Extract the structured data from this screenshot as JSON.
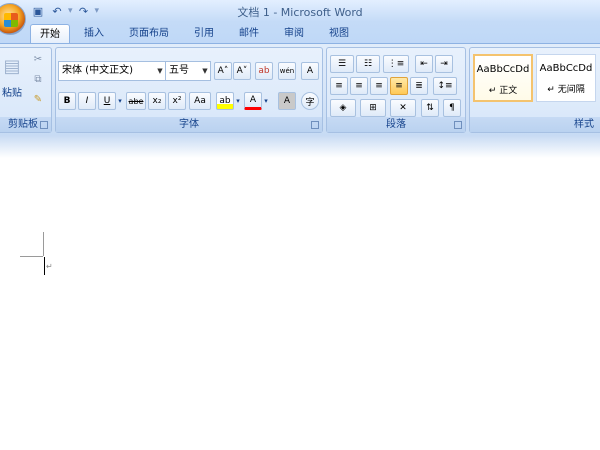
{
  "window": {
    "title": "文档 1 - Microsoft Word"
  },
  "qat": {
    "separator": "▾"
  },
  "tabs": [
    {
      "label": "开始",
      "active": true
    },
    {
      "label": "插入"
    },
    {
      "label": "页面布局"
    },
    {
      "label": "引用"
    },
    {
      "label": "邮件"
    },
    {
      "label": "审阅"
    },
    {
      "label": "视图"
    }
  ],
  "ribbon": {
    "clipboard": {
      "label": "剪贴板",
      "paste": "粘贴"
    },
    "font": {
      "label": "字体",
      "font_name": "宋体 (中文正文)",
      "font_size": "五号",
      "grow": "A˄",
      "shrink": "A˅",
      "clear": "ab",
      "phonetic": "wén",
      "char_border": "A",
      "bold": "B",
      "italic": "I",
      "underline": "U",
      "strike": "abe",
      "subscript": "x₂",
      "superscript": "x²",
      "change_case": "Aa",
      "highlight": "ab",
      "font_color": "A",
      "char_shading": "A",
      "enclose": "字"
    },
    "paragraph": {
      "label": "段落"
    },
    "styles": {
      "label": "样式",
      "items": [
        {
          "sample": "AaBbCcDd",
          "name": "↵ 正文",
          "selected": true
        },
        {
          "sample": "AaBbCcDd",
          "name": "↵ 无间隔"
        }
      ]
    }
  },
  "document": {
    "paragraph_mark": "↵"
  },
  "colors": {
    "accent": "#15428b",
    "ribbon": "#d6e5f8",
    "highlight_yellow": "#ffff00",
    "font_red": "#ff0000"
  }
}
